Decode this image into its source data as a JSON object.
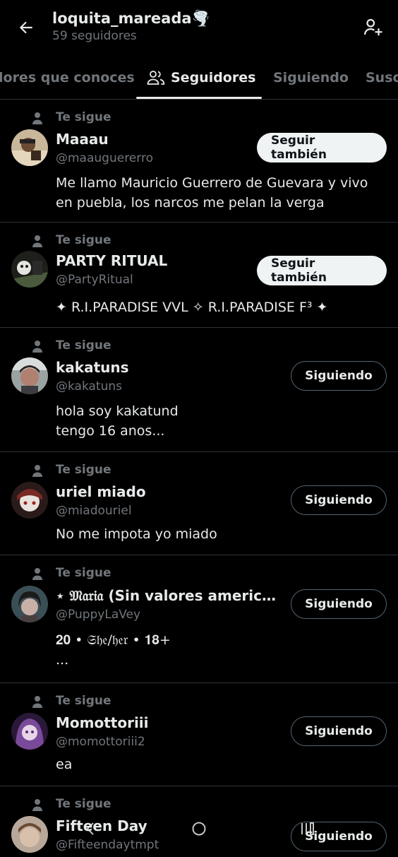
{
  "header": {
    "title": "loquita_mareada🌪️",
    "subtitle": "59 seguidores"
  },
  "tabs": [
    {
      "label": "lores que conoces"
    },
    {
      "label": "Seguidores",
      "active": true
    },
    {
      "label": "Siguiendo"
    },
    {
      "label": "Susc"
    }
  ],
  "follows_you_label": "Te sigue",
  "users": [
    {
      "name": "Maaau",
      "handle": "@maauguererro",
      "bio": "Me llamo Mauricio Guerrero de Guevara y vivo en puebla, los narcos me pelan la verga",
      "button": "Seguir también"
    },
    {
      "name": "PARTY RITUAL",
      "handle": "@PartyRitual",
      "bio": "✦ R.I.PARADISE VVL ✧ R.I.PARADISE F³ ✦",
      "button": "Seguir también"
    },
    {
      "name": "kakatuns",
      "handle": "@kakatuns",
      "bio": "hola soy kakatund\ntengo 16 anos...",
      "button": "Siguiendo"
    },
    {
      "name": "uriel miado",
      "handle": "@miadouriel",
      "bio": "No me impota yo miado",
      "button": "Siguiendo"
    },
    {
      "name": "⋆ 𝔐𝔞𝔯𝔦𝔞 (Sin valores americano...",
      "handle": "@PuppyLaVey",
      "bio": "𝟐𝟎 • 𝔖𝔥𝔢/𝔥𝔢𝔯 • 𝟏𝟖+\n...",
      "button": "Siguiendo"
    },
    {
      "name": "Momottoriii",
      "handle": "@momottoriii2",
      "bio": "ea",
      "button": "Siguiendo"
    },
    {
      "name": "Fifteen Day",
      "handle": "@Fifteendaytmpt",
      "bio": "",
      "button": "Siguiendo"
    }
  ],
  "colors": {
    "background": "#000000",
    "primary_text": "#e7e9ea",
    "secondary_text": "#71767b",
    "divider": "#2f3336",
    "follow_button_bg": "#eff3f4"
  }
}
